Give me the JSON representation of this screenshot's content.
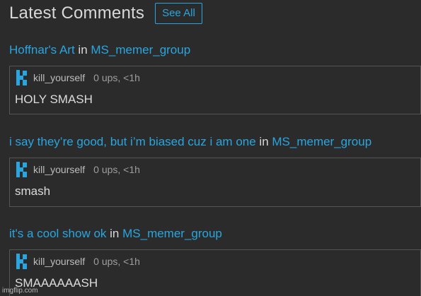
{
  "header": {
    "title": "Latest Comments",
    "see_all_label": "See All"
  },
  "posts": [
    {
      "title": "Hoffnar's Art",
      "in_word": " in ",
      "group": "MS_memer_group",
      "comment": {
        "username": "kill_yourself",
        "meta": "0 ups, <1h",
        "text": "HOLY SMASH"
      }
    },
    {
      "title": "i say they’re good, but i’m biased cuz i am one",
      "in_word": " in ",
      "group": "MS_memer_group",
      "comment": {
        "username": "kill_yourself",
        "meta": "0 ups, <1h",
        "text": "smash"
      }
    },
    {
      "title": "it's a cool show ok",
      "in_word": " in ",
      "group": "MS_memer_group",
      "comment": {
        "username": "kill_yourself",
        "meta": "0 ups, <1h",
        "text": "SMAAAAAASH"
      }
    }
  ],
  "watermark": "imgflip.com",
  "colors": {
    "background": "#2b2b2b",
    "link": "#29a6e0",
    "border": "#555555"
  },
  "icons": {
    "avatar": "avatar-icon"
  }
}
